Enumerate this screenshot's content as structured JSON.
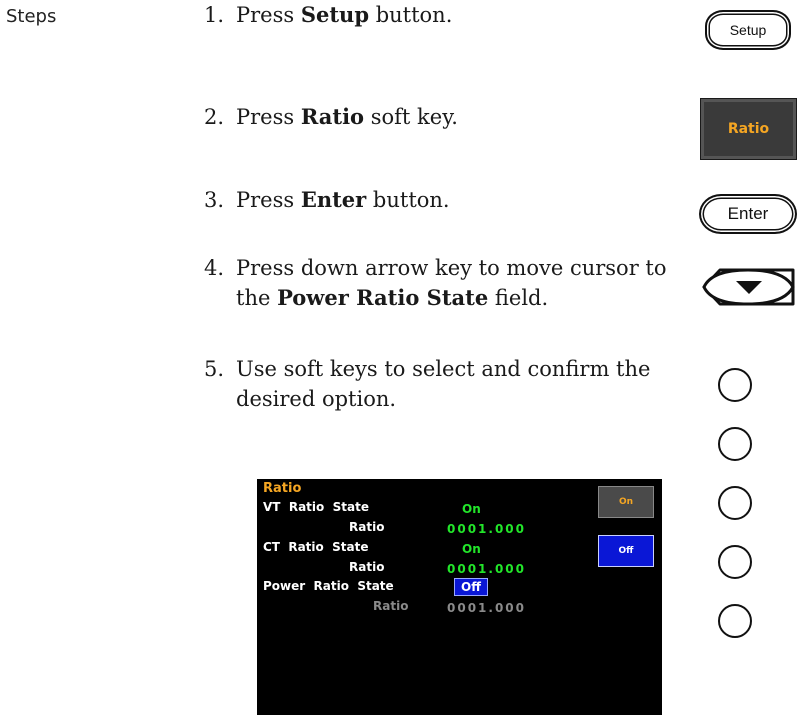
{
  "section_label": "Steps",
  "steps": [
    {
      "num": "1.",
      "pre": "Press ",
      "bold": "Setup",
      "post": " button."
    },
    {
      "num": "2.",
      "pre": "Press ",
      "bold": "Ratio",
      "post": " soft key."
    },
    {
      "num": "3.",
      "pre": "Press ",
      "bold": "Enter",
      "post": " button."
    },
    {
      "num": "4.",
      "pre": "Press down arrow key to move cursor to the ",
      "bold": "Power Ratio State",
      "post": " field."
    },
    {
      "num": "5.",
      "text": "Use soft keys to select and confirm the desired option."
    }
  ],
  "keys": {
    "setup_label": "Setup",
    "ratio_softkey_label": "Ratio",
    "enter_label": "Enter",
    "arrow_icon": "down-arrow-key-icon",
    "round_key_icon": "round-soft-key-icon",
    "round_key_count": 5
  },
  "screen": {
    "title": "Ratio",
    "rows": [
      {
        "label": "VT  Ratio  State",
        "value": "On"
      },
      {
        "label": "Ratio",
        "value": "0001.000"
      },
      {
        "label": "CT  Ratio  State",
        "value": "On"
      },
      {
        "label": "Ratio",
        "value": "0001.000"
      },
      {
        "label": "Power  Ratio  State",
        "value": "Off"
      },
      {
        "label": "Ratio",
        "value": "0001.000"
      }
    ],
    "softkeys": {
      "on": "On",
      "off": "Off"
    },
    "colors": {
      "title": "#f5a623",
      "value": "#22e62a",
      "selected_bg": "#0a17d6",
      "disabled": "#8a8a8a"
    }
  }
}
